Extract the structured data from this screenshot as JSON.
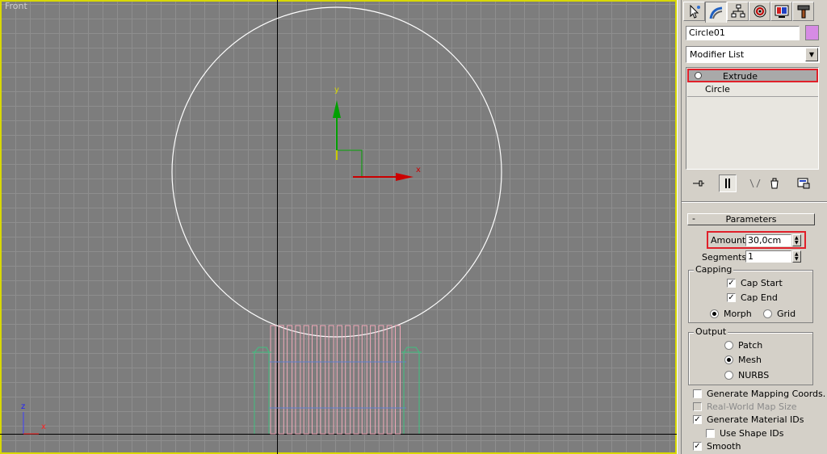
{
  "viewport": {
    "label": "Front",
    "gizmo_y": "y",
    "gizmo_x": "x",
    "corner_z": "z",
    "corner_x": "x"
  },
  "command_panel": {
    "tabs": [
      "create-icon",
      "modify-icon",
      "hierarchy-icon",
      "motion-icon",
      "display-icon",
      "utilities-icon"
    ],
    "object_name": "Circle01",
    "object_color": "#d68be4",
    "modifier_list": "Modifier List",
    "stack": [
      "Extrude",
      "Circle"
    ],
    "stack_tools": [
      "pin-stack-icon",
      "show-end-result-icon",
      "make-unique-icon",
      "remove-modifier-icon",
      "configure-sets-icon"
    ]
  },
  "parameters": {
    "title": "Parameters",
    "collapse_symbol": "-",
    "amount_label": "Amount:",
    "amount_value": "30,0cm",
    "segments_label": "Segments:",
    "segments_value": "1",
    "capping": {
      "title": "Capping",
      "cap_start": "Cap Start",
      "cap_end": "Cap End",
      "morph": "Morph",
      "grid": "Grid"
    },
    "output": {
      "title": "Output",
      "patch": "Patch",
      "mesh": "Mesh",
      "nurbs": "NURBS"
    },
    "generate_mapping": "Generate Mapping Coords.",
    "real_world": "Real-World Map Size",
    "generate_material_ids": "Generate Material IDs",
    "use_shape_ids": "Use Shape IDs",
    "smooth": "Smooth"
  },
  "colors": {
    "highlight": "#e0202a",
    "gizmo_x": "#cc0000",
    "gizmo_y": "#00a000",
    "fence_pink": "#f0a8b8",
    "fence_green": "#40c080",
    "fence_blue": "#6080d0"
  }
}
